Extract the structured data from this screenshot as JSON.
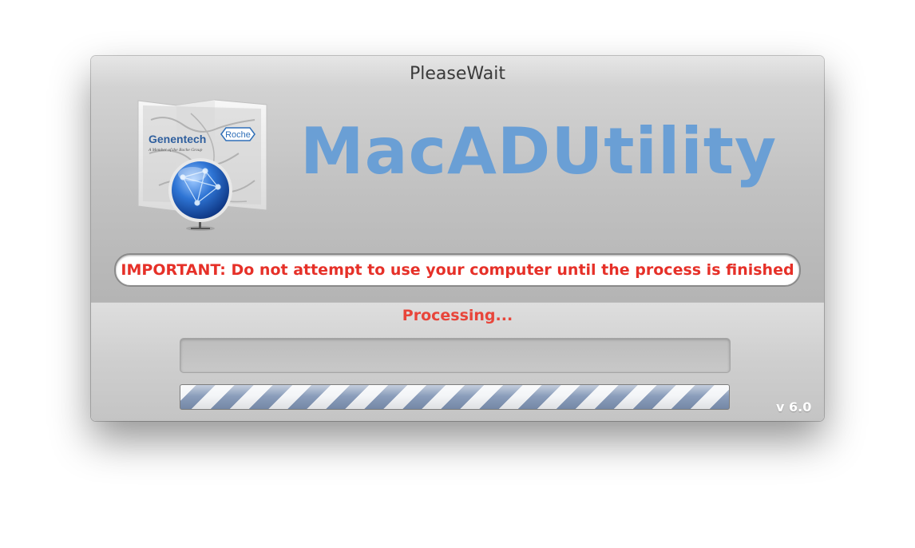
{
  "window": {
    "title": "PleaseWait"
  },
  "app": {
    "name": "MacADUtility",
    "icon": "network-globe-map-icon",
    "logo_genentech": "Genentech",
    "logo_genentech_tagline": "A Member of the Roche Group",
    "logo_roche": "Roche"
  },
  "warning": {
    "text": "IMPORTANT: Do not attempt to use your computer until the process is finished"
  },
  "status": {
    "text": "Processing..."
  },
  "progress": {
    "indeterminate": true
  },
  "version": {
    "text": "v 6.0"
  },
  "colors": {
    "app_name": "#6a9fd5",
    "warning_text": "#e63028",
    "status_text": "#e8453a",
    "progress_stripe": "#7e93b4"
  }
}
